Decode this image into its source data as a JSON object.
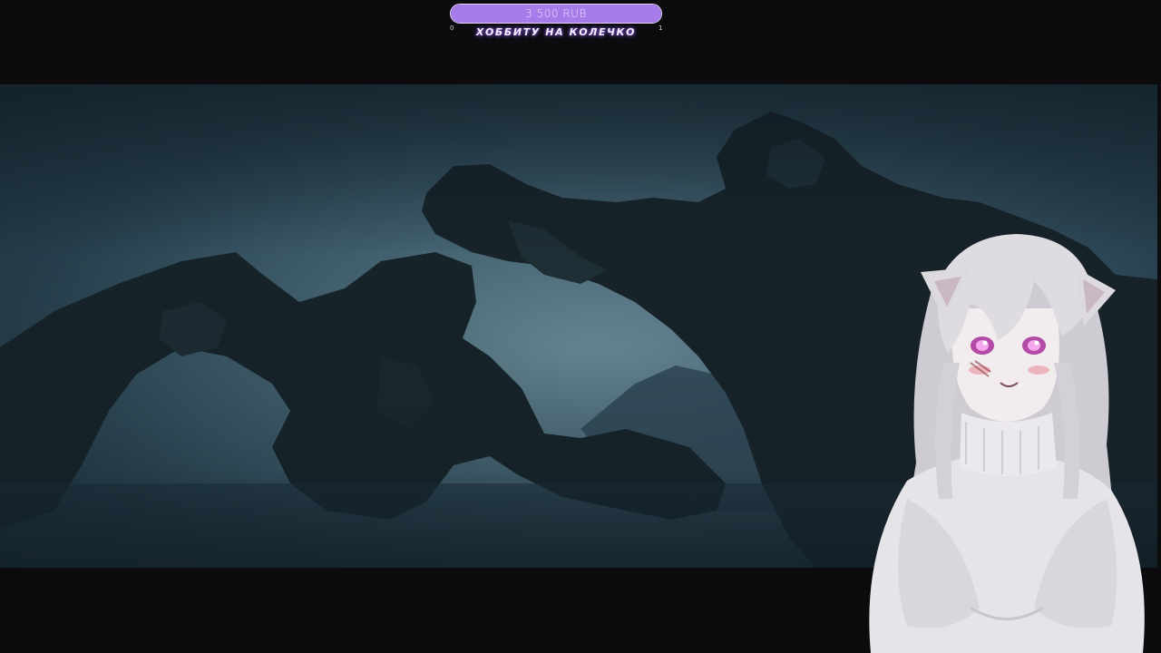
{
  "donation_goal": {
    "amount": "3 500 RUB",
    "title": "ХОББИТУ НА КОЛЕЧКО",
    "min_label": "0",
    "max_label": "1",
    "progress_fraction": 1.0,
    "fill_color": "#a57ce9",
    "text_color": "#ece2ff"
  },
  "video": {
    "scene": "dark floating rock formations in a foggy teal sky",
    "palette": [
      "#1a2d38",
      "#3d5a69",
      "#5d7e8c",
      "#141c22"
    ]
  },
  "avatar": {
    "hair_color": "#d9d6dc",
    "eye_color": "#e27ad8",
    "sweater_color": "#e8e6ea"
  }
}
